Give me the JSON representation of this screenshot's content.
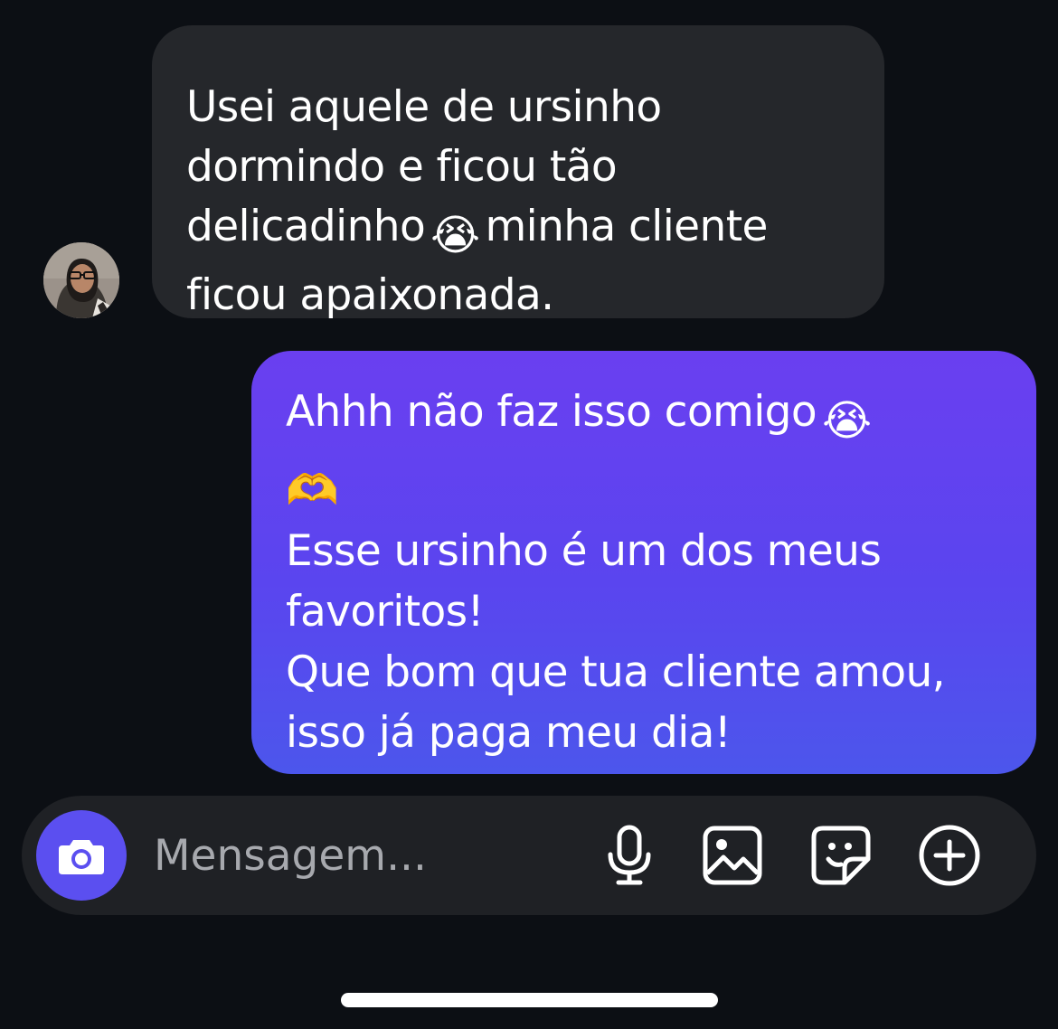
{
  "conversation": {
    "incoming": {
      "lines": [
        {
          "text": "Usei aquele de ursinho"
        },
        {
          "text": "dormindo e ficou tão"
        },
        {
          "text": "delicadinho",
          "emoji": "😭",
          "after": "minha cliente"
        },
        {
          "text": "ficou apaixonada."
        }
      ]
    },
    "outgoing": {
      "lines": [
        {
          "text": "Ahhh não faz isso comigo",
          "emoji": "😭"
        },
        {
          "emoji": "🫶"
        },
        {
          "text": "Esse ursinho é um dos meus"
        },
        {
          "text": "favoritos!"
        },
        {
          "text": "Que bom que tua cliente amou,"
        },
        {
          "text": "isso já paga meu dia!"
        }
      ]
    }
  },
  "composer": {
    "placeholder": "Mensagem...",
    "camera_icon": "camera-icon",
    "tools": [
      "microphone-icon",
      "image-icon",
      "sticker-icon",
      "add-icon"
    ]
  },
  "colors": {
    "background": "#0c0f14",
    "incoming_bubble": "#25272b",
    "outgoing_bubble_top": "#6a3ff0",
    "outgoing_bubble_bottom": "#4c56ec",
    "camera_button": "#5b4ff0",
    "composer": "#1f2125",
    "placeholder": "#a7a9ae"
  }
}
